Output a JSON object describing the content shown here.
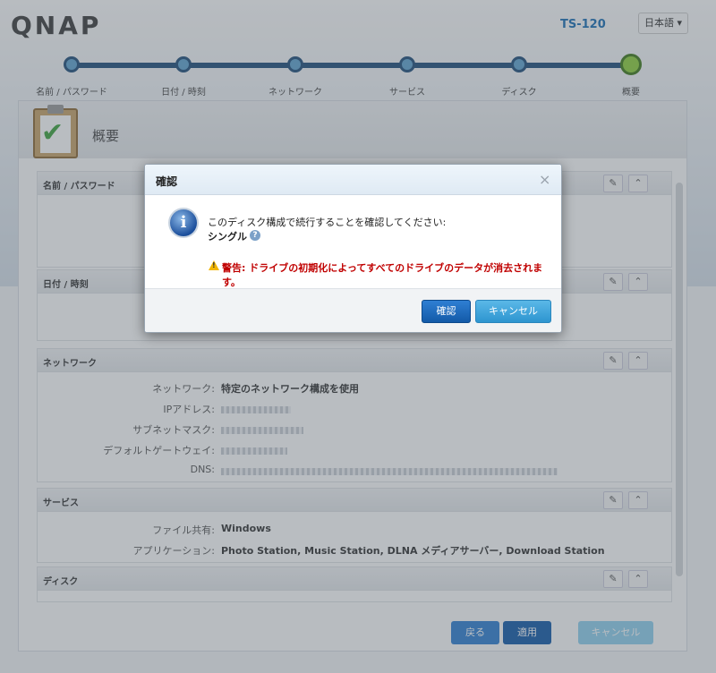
{
  "app": {
    "logo": "QNAP",
    "model": "TS-120",
    "language": "日本語 ▾"
  },
  "steps": [
    {
      "label": "名前 / パスワード"
    },
    {
      "label": "日付 / 時刻"
    },
    {
      "label": "ネットワーク"
    },
    {
      "label": "サービス"
    },
    {
      "label": "ディスク"
    },
    {
      "label": "概要"
    }
  ],
  "panel": {
    "title": "概要",
    "sections": {
      "name": {
        "title": "名前 / パスワード"
      },
      "datetime": {
        "title": "日付 / 時刻"
      },
      "network": {
        "title": "ネットワーク",
        "network_label": "ネットワーク:",
        "network_value": "特定のネットワーク構成を使用",
        "ip_label": "IPアドレス:",
        "subnet_label": "サブネットマスク:",
        "gateway_label": "デフォルトゲートウェイ:",
        "dns_label": "DNS:"
      },
      "services": {
        "title": "サービス",
        "fileshare_label": "ファイル共有:",
        "fileshare_value": "Windows",
        "apps_label": "アプリケーション:",
        "apps_value": "Photo Station, Music Station, DLNA メディアサーバー, Download Station"
      },
      "disk": {
        "title": "ディスク"
      }
    }
  },
  "footer": {
    "back": "戻る",
    "apply": "適用",
    "cancel": "キャンセル"
  },
  "dialog": {
    "title": "確認",
    "close": "×",
    "message": "このディスク構成で続行することを確認してください:",
    "config": "シングル",
    "help": "?",
    "warning": "警告: ドライブの初期化によってすべてのドライブのデータが消去されます。",
    "confirm": "確認",
    "cancel": "キャンセル"
  },
  "colors": {
    "accent": "#1f4d7a",
    "warning": "#c00000",
    "confirm_button": "#135aa8",
    "cancel_button": "#2d95d0"
  }
}
